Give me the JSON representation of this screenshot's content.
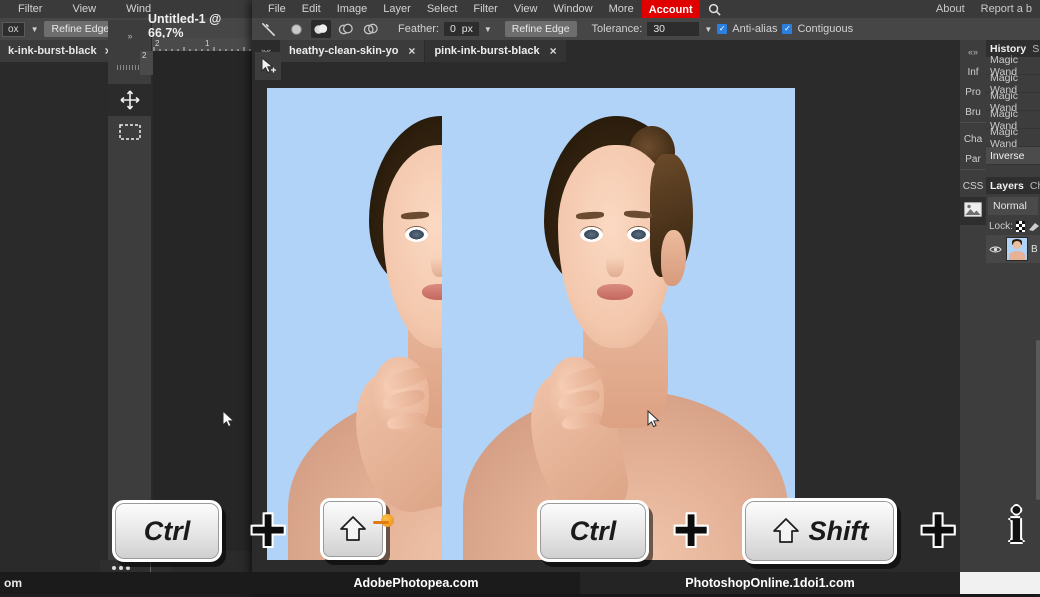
{
  "background_window": {
    "menu_items": [
      "Filter",
      "View",
      "Wind"
    ],
    "options": {
      "box_label": "ox",
      "refine_edge": "Refine Edge"
    },
    "tab": {
      "label": "k-ink-burst-black",
      "close": "×"
    },
    "status_text": "om"
  },
  "foreground_window": {
    "menu_items": [
      "File",
      "Edit",
      "Image",
      "Layer",
      "Select",
      "Filter",
      "View",
      "Window",
      "More"
    ],
    "account_label": "Account",
    "search_icon": "search-icon",
    "right_menu": [
      "About",
      "Report a b"
    ],
    "options_bar": {
      "tool_icon": "magic-wand-icon",
      "selection_modes": [
        "new-selection",
        "add-to-selection",
        "subtract-from-selection",
        "intersect-with-selection"
      ],
      "active_selection_mode_index": 1,
      "feather_label": "Feather:",
      "feather_value": "0",
      "feather_unit": "px",
      "refine_edge_label": "Refine Edge",
      "tolerance_label": "Tolerance:",
      "tolerance_value": "30",
      "antialias_label": "Anti-alias",
      "antialias_checked": true,
      "contiguous_label": "Contiguous",
      "contiguous_checked": true,
      "accent_checkbox_color": "#2a7fe0"
    },
    "tabs": [
      {
        "label": "heathy-clean-skin-yo",
        "close": "×",
        "active": true
      },
      {
        "label": "pink-ink-burst-black",
        "close": "×",
        "active": false
      }
    ]
  },
  "document_title": "Untitled-1 @ 66,7%",
  "rulers": {
    "ticks": [
      "2",
      "1"
    ],
    "vertical_tick": "2"
  },
  "toolbar": {
    "collapse_icon": "double-chevron-icon",
    "tools": [
      "move-tool",
      "rectangular-marquee-tool"
    ],
    "active_tool_index": 0,
    "secondary_cursor_icon": "move-cursor-icon"
  },
  "right_rail": {
    "collapse_icon": "collapse-chevrons-icon",
    "tabs": [
      "Inf",
      "Pro",
      "Bru",
      "Cha",
      "Par",
      "CSS"
    ],
    "image_icon": "image-panel-icon"
  },
  "history_panel": {
    "tab_active": "History",
    "tab_inactive": "S",
    "entries": [
      "Magic Wand",
      "Magic Wand",
      "Magic Wand",
      "Magic Wand",
      "Magic Wand",
      "Inverse"
    ],
    "selected_entry_index": 5
  },
  "layers_panel": {
    "tab_active": "Layers",
    "tab_inactive": "Ch",
    "blend_mode": "Normal",
    "lock_label": "Lock:",
    "lock_icons": [
      "transparency-lock-icon",
      "brush-lock-icon"
    ],
    "layer": {
      "visibility_icon": "eye-icon",
      "thumbnail": "layer-thumbnail",
      "name": "B"
    }
  },
  "canvas": {
    "background_color": "#b2d3f8",
    "selection_style": "marching-ants",
    "left_document_label": "left-canvas",
    "right_document_label": "right-canvas"
  },
  "key_overlay": {
    "left": {
      "key1": "Ctrl",
      "operator": "+",
      "key2_icon": "shift-arrow-icon",
      "key2": ""
    },
    "right": {
      "key1": "Ctrl",
      "operator": "+",
      "key2_icon": "shift-arrow-icon",
      "key2": "Shift"
    },
    "trailing_operator": "+",
    "trailing_char": "i"
  },
  "watermarks": {
    "left": "AdobePhotopea.com",
    "right": "PhotoshopOnline.1doi1.com"
  }
}
